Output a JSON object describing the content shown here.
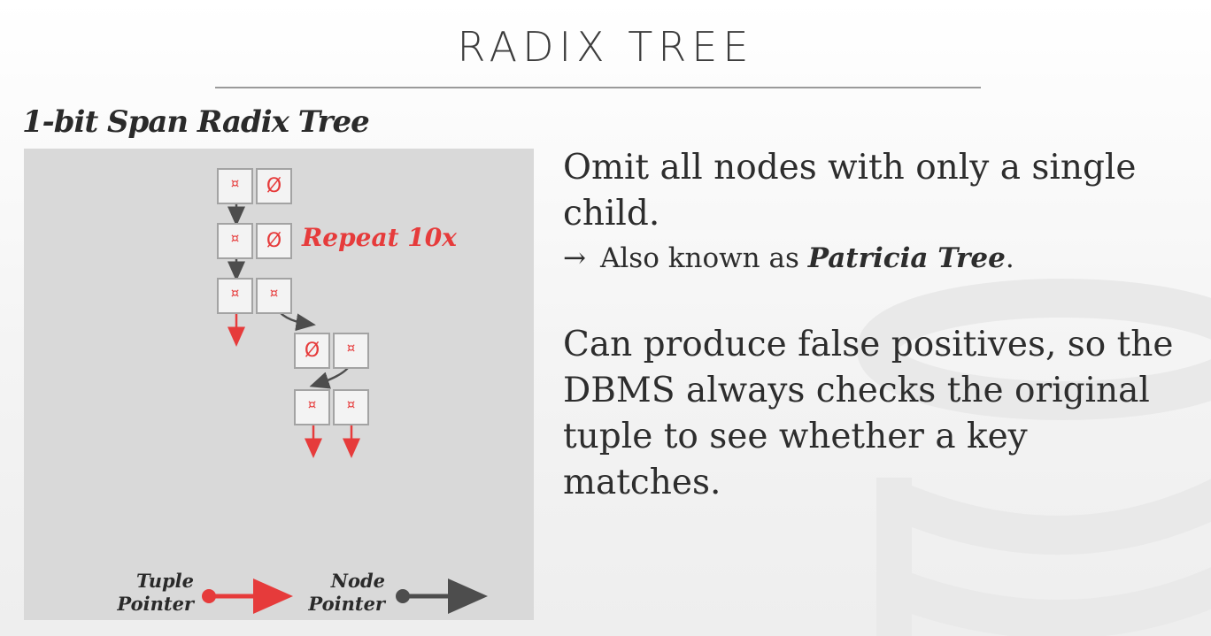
{
  "slide": {
    "title": "RADIX TREE",
    "subtitle": "1-bit Span Radix Tree"
  },
  "diagram": {
    "annotation": "Repeat 10x",
    "pointer_symbol": "¤",
    "null_symbol": "Ø",
    "legend": {
      "tuple_line1": "Tuple",
      "tuple_line2": "Pointer",
      "node_line1": "Node",
      "node_line2": "Pointer"
    },
    "colors": {
      "tuple": "#e63b3b",
      "node": "#4d4d4d",
      "panel": "#d9d9d9"
    }
  },
  "text": {
    "point1": "Omit all nodes with only a single child.",
    "sub_arrow": "→",
    "sub_prefix": "Also known as",
    "sub_emphasis": "Patricia Tree",
    "sub_suffix": ".",
    "point2": "Can produce false positives, so the DBMS always checks the original tuple to see whether a key matches."
  }
}
